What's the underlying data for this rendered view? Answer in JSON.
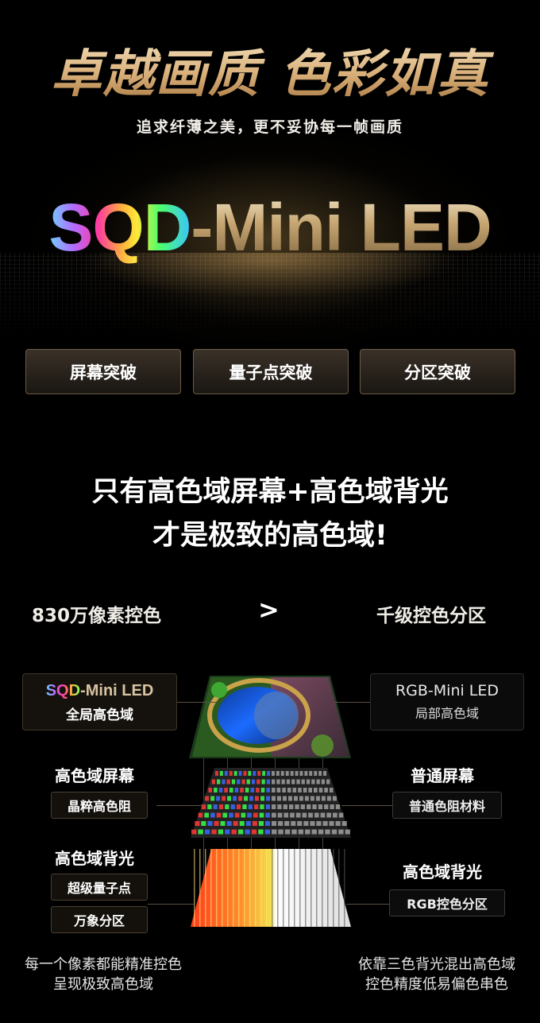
{
  "hero": {
    "title": "卓越画质 色彩如真",
    "subtitle": "追求纤薄之美，更不妥协每一帧画质",
    "logo_part1": "SQD",
    "logo_part2": "-Mini LED"
  },
  "tabs": [
    {
      "label": "屏幕突破"
    },
    {
      "label": "量子点突破"
    },
    {
      "label": "分区突破"
    }
  ],
  "headline": {
    "line1": "只有高色域屏幕+高色域背光",
    "line2": "才是极致的高色域!"
  },
  "comparison": {
    "left": "830万像素控色",
    "symbol": ">",
    "right": "千级控色分区"
  },
  "left_panel": {
    "brand_a": "SQD",
    "brand_b": "-Mini LED",
    "subtitle": "全局高色域",
    "screen_title": "高色域屏幕",
    "screen_pill": "晶粹高色阻",
    "backlight_title": "高色域背光",
    "backlight_pill1": "超级量子点",
    "backlight_pill2": "万象分区",
    "footer_line1": "每一个像素都能精准控色",
    "footer_line2": "呈现极致高色域"
  },
  "right_panel": {
    "brand": "RGB-Mini LED",
    "subtitle": "局部高色域",
    "screen_title": "普通屏幕",
    "screen_pill": "普通色阻材料",
    "backlight_title": "高色域背光",
    "backlight_pill": "RGB控色分区",
    "footer_line1": "依靠三色背光混出高色域",
    "footer_line2": "控色精度低易偏色串色"
  },
  "colors": {
    "gold": "#d9b07a",
    "background": "#000000"
  }
}
